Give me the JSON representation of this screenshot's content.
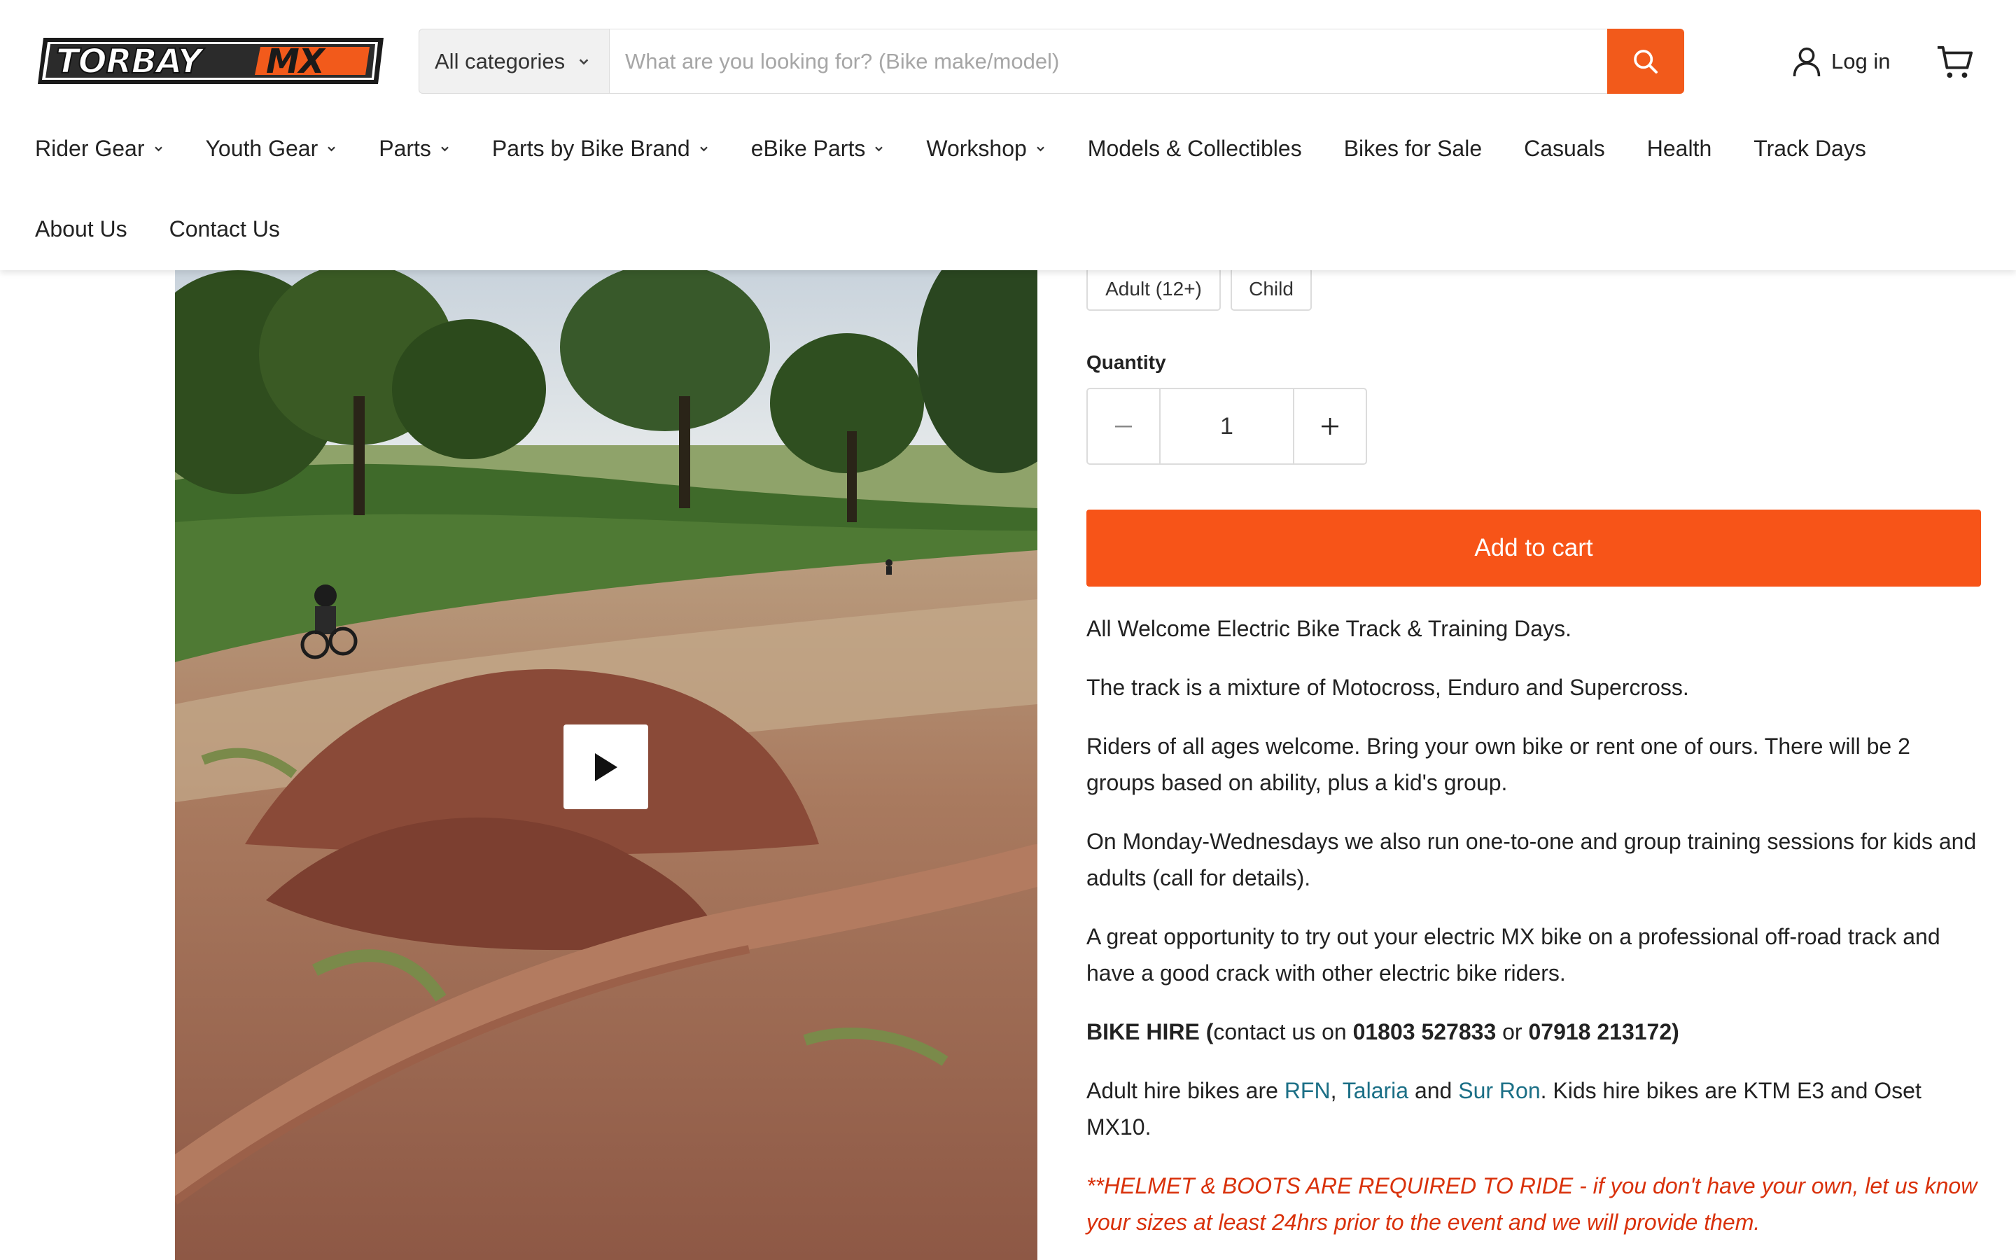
{
  "header": {
    "logo_text": "TORBAY MX",
    "search": {
      "category_label": "All categories",
      "placeholder": "What are you looking for? (Bike make/model)"
    },
    "login_label": "Log in",
    "icons": {
      "search": "search-icon",
      "user": "user-icon",
      "cart": "cart-icon"
    }
  },
  "nav": {
    "items": [
      {
        "label": "Rider Gear",
        "dropdown": true
      },
      {
        "label": "Youth Gear",
        "dropdown": true
      },
      {
        "label": "Parts",
        "dropdown": true
      },
      {
        "label": "Parts by Bike Brand",
        "dropdown": true
      },
      {
        "label": "eBike Parts",
        "dropdown": true
      },
      {
        "label": "Workshop",
        "dropdown": true
      },
      {
        "label": "Models & Collectibles",
        "dropdown": false
      },
      {
        "label": "Bikes for Sale",
        "dropdown": false
      },
      {
        "label": "Casuals",
        "dropdown": false
      },
      {
        "label": "Health",
        "dropdown": false
      },
      {
        "label": "Track Days",
        "dropdown": false
      },
      {
        "label": "About Us",
        "dropdown": false
      },
      {
        "label": "Contact Us",
        "dropdown": false
      }
    ]
  },
  "product": {
    "variants": [
      "Adult (12+)",
      "Child"
    ],
    "quantity_label": "Quantity",
    "quantity_value": "1",
    "add_to_cart_label": "Add to cart",
    "description": {
      "p1": "All Welcome Electric Bike Track & Training Days.",
      "p2": "The track is a mixture of Motocross, Enduro and Supercross.",
      "p3": "Riders of all ages welcome. Bring your own bike or rent one of ours. There will be 2 groups based on ability, plus a kid's group.",
      "p4": "On Monday-Wednesdays we also run one-to-one and group training sessions for kids and adults (call for details).",
      "p5": "A great opportunity to try out your electric MX bike on a professional off-road track and have a good crack with other electric bike riders.",
      "hire": {
        "heading": "BIKE HIRE (",
        "contact_text": "contact us on ",
        "phone1": "01803 527833",
        "or_text": " or ",
        "phone2": "07918 213172)"
      },
      "bikes": {
        "prefix": "Adult hire bikes are ",
        "link1": "RFN",
        "comma": ", ",
        "link2": "Talaria",
        "and_text": " and ",
        "link3": "Sur Ron",
        "suffix": ". Kids hire bikes are KTM E3 and Oset MX10."
      },
      "warning": "**HELMET & BOOTS ARE REQUIRED TO RIDE - if you don't have your own, let us know your sizes at least 24hrs prior to the event and we will provide them."
    }
  },
  "colors": {
    "accent": "#f75418",
    "link": "#1b6f86",
    "warning": "#d9310b",
    "text": "#222222"
  }
}
